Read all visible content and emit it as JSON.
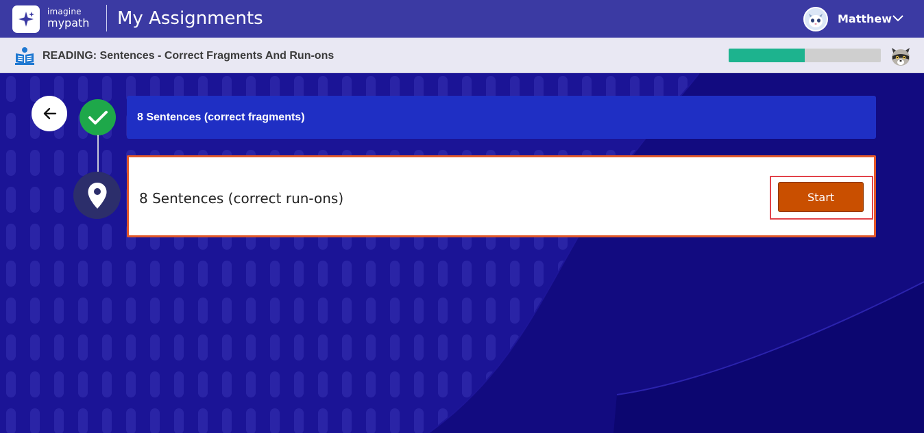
{
  "header": {
    "logo_line1": "imagine",
    "logo_line2": "mypath",
    "title": "My Assignments",
    "user_name": "Matthew",
    "user_menu_icon": "chevron-down-icon",
    "bg_color": "#3b3aa3"
  },
  "assignment": {
    "subject": "READING: Sentences - Correct Fragments And Run-ons",
    "progress_fraction": 0.5,
    "progress_color": "#1db38e"
  },
  "lessons": [
    {
      "label": "8 Sentences (correct fragments)",
      "status": "complete",
      "icon": "checkmark-icon"
    },
    {
      "label": "8 Sentences (correct run-ons)",
      "status": "current",
      "icon": "location-pin-icon",
      "action_label": "Start"
    }
  ],
  "navigation": {
    "back_icon": "arrow-left-icon"
  },
  "colors": {
    "background": "#1b1496",
    "complete": "#1ea84a",
    "start_button": "#c94f00",
    "current_border": "#e2592a"
  }
}
